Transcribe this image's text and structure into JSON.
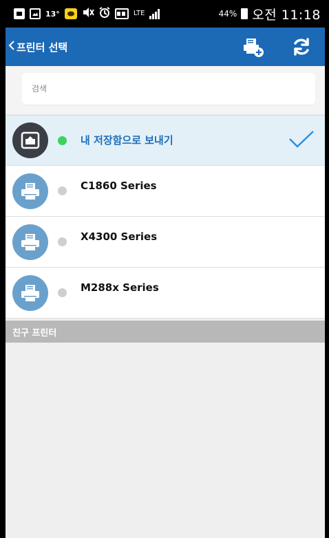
{
  "status_bar": {
    "temperature": "13°",
    "network": "LTE",
    "battery_pct": "44%",
    "time": "오전 11:18",
    "icons": [
      "notification-icon",
      "gallery-icon",
      "kakaotalk-icon",
      "mute-icon",
      "alarm-icon",
      "nfc-icon",
      "lte-icon",
      "signal-icon",
      "battery-icon"
    ]
  },
  "app_bar": {
    "title": "프린터 선택",
    "back_icon": "chevron-left-icon",
    "actions": [
      "add-printer-icon",
      "refresh-icon"
    ],
    "color": "#1c69b6"
  },
  "search": {
    "placeholder": "검색",
    "value": ""
  },
  "printers": [
    {
      "label": "내 저장함으로 보내기",
      "status": "online",
      "icon": "storage-box-icon",
      "selected": true
    },
    {
      "label": "C1860 Series",
      "status": "offline",
      "icon": "printer-icon",
      "selected": false
    },
    {
      "label": "X4300 Series",
      "status": "offline",
      "icon": "printer-icon",
      "selected": false
    },
    {
      "label": "M288x Series",
      "status": "offline",
      "icon": "printer-icon",
      "selected": false
    }
  ],
  "section": {
    "friend_printers": "친구 프린터"
  },
  "colors": {
    "online": "#3dd35b",
    "offline": "#cfcfcf",
    "selected_bg": "#e3f0f8",
    "selected_text": "#1d6fb8",
    "printer_avatar": "#6aa1cc"
  }
}
